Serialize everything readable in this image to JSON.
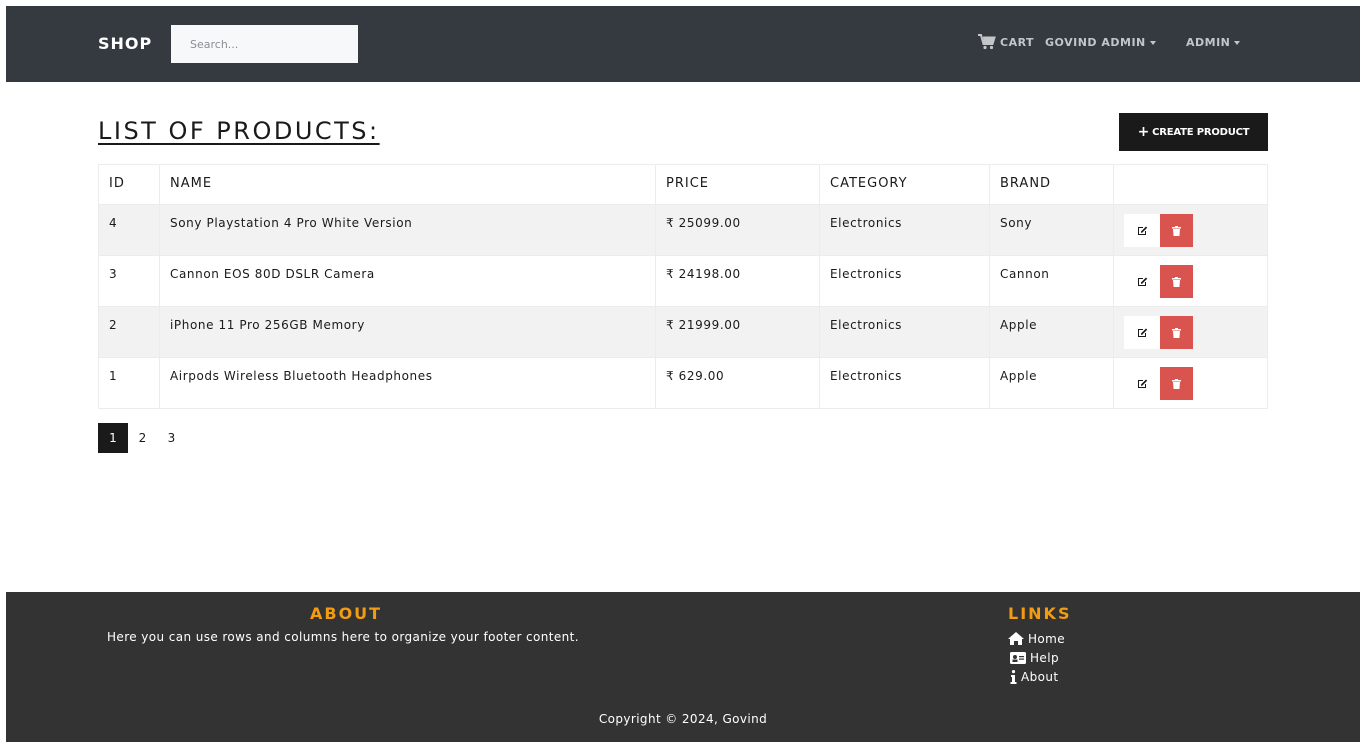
{
  "navbar": {
    "brand": "SHOP",
    "search_placeholder": "Search...",
    "cart_label": "CART",
    "user_menu": "GOVIND ADMIN",
    "admin_menu": "ADMIN"
  },
  "main": {
    "title": "LIST OF PRODUCTS:",
    "create_button": "CREATE PRODUCT",
    "table": {
      "headers": [
        "ID",
        "NAME",
        "PRICE",
        "CATEGORY",
        "BRAND",
        ""
      ],
      "rows": [
        {
          "id": "4",
          "name": "Sony Playstation 4 Pro White Version",
          "price": "₹ 25099.00",
          "category": "Electronics",
          "brand": "Sony"
        },
        {
          "id": "3",
          "name": "Cannon EOS 80D DSLR Camera",
          "price": "₹ 24198.00",
          "category": "Electronics",
          "brand": "Cannon"
        },
        {
          "id": "2",
          "name": "iPhone 11 Pro 256GB Memory",
          "price": "₹ 21999.00",
          "category": "Electronics",
          "brand": "Apple"
        },
        {
          "id": "1",
          "name": "Airpods Wireless Bluetooth Headphones",
          "price": "₹ 629.00",
          "category": "Electronics",
          "brand": "Apple"
        }
      ]
    },
    "pagination": {
      "pages": [
        "1",
        "2",
        "3"
      ],
      "active": "1"
    }
  },
  "footer": {
    "about_title": "ABOUT",
    "about_text": "Here you can use rows and columns here to organize your footer content.",
    "links_title": "LINKS",
    "links": [
      {
        "label": "Home",
        "icon": "home-icon"
      },
      {
        "label": "Help",
        "icon": "id-card-icon"
      },
      {
        "label": "About",
        "icon": "info-icon"
      }
    ],
    "copyright": "Copyright © 2024, Govind"
  },
  "colors": {
    "navbar_bg": "#343a40",
    "footer_bg": "#333333",
    "accent": "#f39c12",
    "delete": "#d9534f",
    "primary_dark": "#1a1a1a"
  }
}
